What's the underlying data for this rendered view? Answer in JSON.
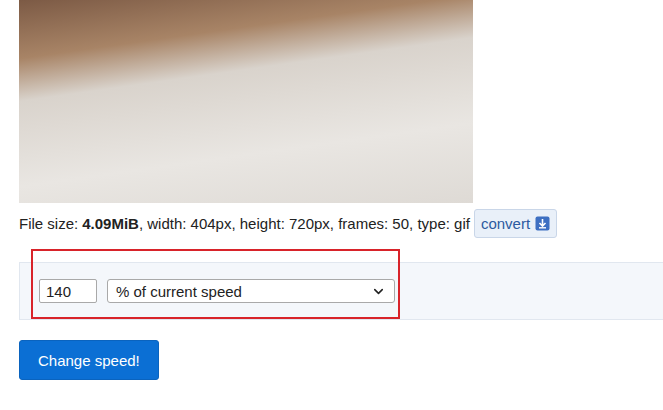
{
  "file_info": {
    "size_label": "File size:",
    "size": "4.09MiB",
    "details": ", width: 404px, height: 720px, frames: 50, type: gif"
  },
  "convert_button": {
    "label": "convert"
  },
  "speed_form": {
    "value": "140",
    "unit": "% of current speed",
    "highlighted": true
  },
  "submit_button": {
    "label": "Change speed!"
  }
}
